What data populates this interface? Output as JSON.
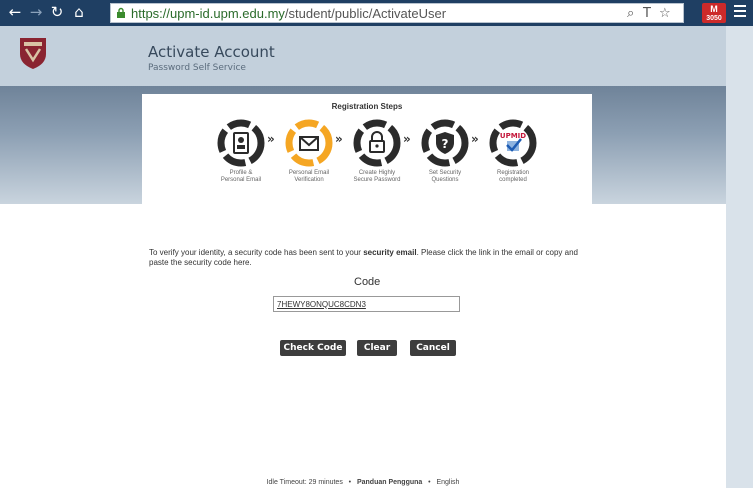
{
  "browser": {
    "url_host": "https://upm-id.upm.edu.my",
    "url_path": "/student/public/ActivateUser",
    "extension_badge_line1": "M",
    "extension_badge_line2": "3050"
  },
  "header": {
    "title": "Activate Account",
    "subtitle": "Password Self Service"
  },
  "steps": {
    "title": "Registration Steps",
    "items": [
      {
        "line1": "Profile &",
        "line2": "Personal Email",
        "icon": "profile-icon"
      },
      {
        "line1": "Personal Email",
        "line2": "Verification",
        "icon": "email-icon"
      },
      {
        "line1": "Create Highly",
        "line2": "Secure Password",
        "icon": "lock-icon"
      },
      {
        "line1": "Set Security",
        "line2": "Questions",
        "icon": "question-icon"
      },
      {
        "line1": "Registration",
        "line2": "completed",
        "icon": "checkmark-icon"
      }
    ],
    "completed_logo_text": "UPMID"
  },
  "verify": {
    "text_before": "To verify your identity, a security code has been sent to your ",
    "bold": "security email",
    "text_after": ". Please click the link in the email or copy and paste the security code here."
  },
  "code": {
    "label": "Code",
    "value": "7HEWY8ONQUC8CDN3"
  },
  "buttons": {
    "check": "Check Code",
    "clear": "Clear",
    "cancel": "Cancel"
  },
  "footer": {
    "idle": "Idle Timeout: 29 minutes",
    "sep1": "•",
    "guide": "Panduan Pengguna",
    "sep2": "•",
    "language": "English"
  },
  "colors": {
    "active_step": "#f5a623",
    "step_dark": "#2b2b2b"
  }
}
